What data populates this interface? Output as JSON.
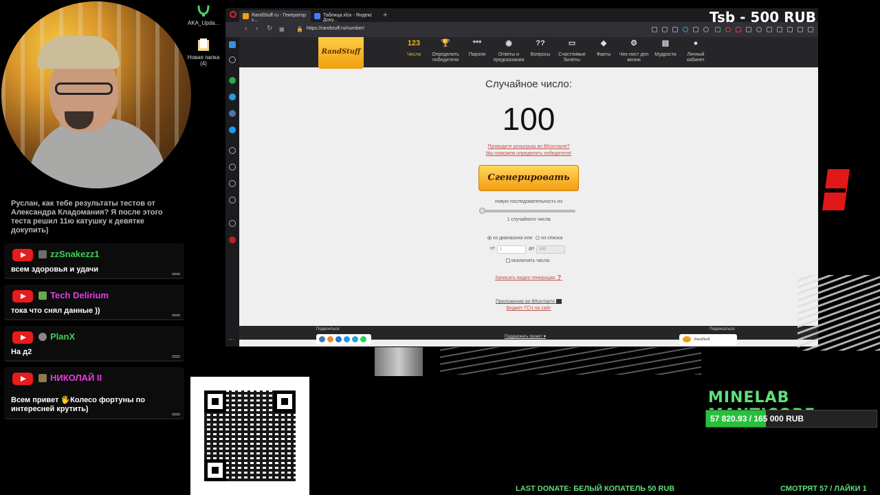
{
  "overlay": {
    "price_tag": "Tsb - 500 RUB",
    "goal_title": "MINELAB MANTICORE",
    "goal_text": "57 820.93 / 165 000 RUB",
    "goal_progress": 0.35,
    "last_donate": "LAST DONATE: БЕЛЫЙ КОПАТЕЛЬ  50 RUB",
    "viewers": "СМОТРЯТ 57 / ЛАЙКИ 1",
    "accent": "#5fe07a"
  },
  "desktop": {
    "icons": [
      {
        "label": "AKA_Upda...",
        "icon": "app-icon"
      },
      {
        "label": "Новая папка (4)",
        "icon": "folder-icon"
      }
    ]
  },
  "chat": {
    "previous_message": "Руслан, как тебе результаты тестов от Александра Кладомания? Я после этого теста решил 11ю катушку к девятке докупить)",
    "messages": [
      {
        "name": "zzSnakezz1",
        "name_color": "#39d353",
        "text": "всем здоровья и удачи"
      },
      {
        "name": "Tech Delirium",
        "name_color": "#e040e0",
        "text": "тока что снял данные ))"
      },
      {
        "name": "PlanX",
        "name_color": "#39d353",
        "text": "На д2"
      },
      {
        "name": "НИКОЛАЙ II",
        "name_color": "#e040e0",
        "text": "Всем привет 🖐Колесо фортуны по интересней крутить)"
      }
    ]
  },
  "browser": {
    "tabs": [
      {
        "label": "RandStuff.ru - Генератор с...",
        "active": true
      },
      {
        "label": "Таблица.xlsx - Яндекс Доку...",
        "active": false
      }
    ],
    "new_tab": "+",
    "url": "https://randstuff.ru/number/"
  },
  "site": {
    "logo": "RandStuff",
    "nav": [
      {
        "icon": "123",
        "label": "Числа",
        "active": true
      },
      {
        "icon": "🏆",
        "label": "Определить победителя",
        "active": false
      },
      {
        "icon": "***",
        "label": "Пароли",
        "active": false
      },
      {
        "icon": "◉",
        "label": "Ответы и предсказания",
        "active": false
      },
      {
        "icon": "??",
        "label": "Вопросы",
        "active": false
      },
      {
        "icon": "▭",
        "label": "Счастливые билеты",
        "active": false
      },
      {
        "icon": "◆",
        "label": "Факты",
        "active": false
      },
      {
        "icon": "⚙",
        "label": "Чек-лист дел жизни",
        "active": false
      },
      {
        "icon": "▤",
        "label": "Мудрости",
        "active": false
      },
      {
        "icon": "●",
        "label": "Личный кабинет",
        "active": false
      }
    ],
    "heading": "Случайное число:",
    "number": "100",
    "promo1": "Проводите розыгрыш во ВКонтакте?",
    "promo2": "Мы поможем определить победителя!",
    "generate": "Сгенерировать",
    "sequence_label": "новую последовательность из",
    "count_label": "1 случайного числа",
    "radio_range": "из диапазона или",
    "radio_list": "из списка",
    "from_label": "от",
    "from_value": "1",
    "to_label": "до",
    "to_value": "100",
    "exclude": "исключить числа",
    "record_video": "Записать видео генерации",
    "vk_app": "Приложение во ВКонтакте",
    "widget": "Виджет ГСЧ на сайт",
    "share_label": "Поделиться:",
    "support": "Поддержать проект ♥",
    "subscribe_label": "Подписаться:",
    "subscribe_name": "RandStuff"
  }
}
